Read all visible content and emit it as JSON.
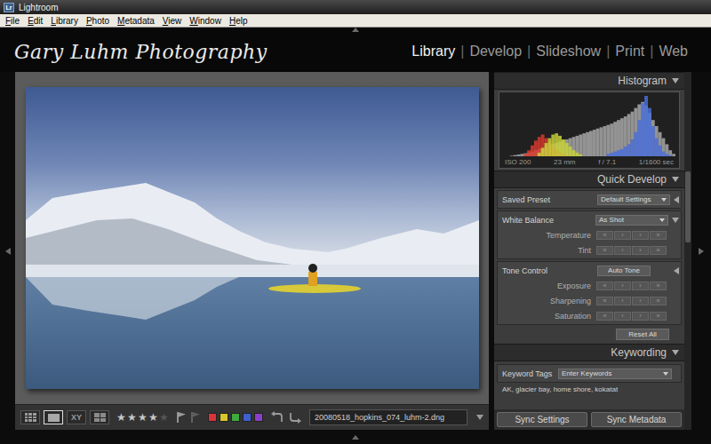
{
  "window": {
    "title": "Lightroom",
    "icon_label": "Lr"
  },
  "menu": [
    "File",
    "Edit",
    "Library",
    "Photo",
    "Metadata",
    "View",
    "Window",
    "Help"
  ],
  "identity_plate": "Gary Luhm Photography",
  "modules": {
    "separator": "|",
    "items": [
      {
        "label": "Library",
        "selected": true
      },
      {
        "label": "Develop",
        "selected": false
      },
      {
        "label": "Slideshow",
        "selected": false
      },
      {
        "label": "Print",
        "selected": false
      },
      {
        "label": "Web",
        "selected": false
      }
    ]
  },
  "toolbar": {
    "view_modes": [
      {
        "kind": "grid",
        "selected": false
      },
      {
        "kind": "loupe",
        "selected": true
      },
      {
        "kind": "compare",
        "label": "XY",
        "selected": false
      },
      {
        "kind": "survey",
        "selected": false
      }
    ],
    "rating": {
      "stars": 4,
      "out_of": 5,
      "glyph": "★"
    },
    "flags": [
      {
        "kind": "pick",
        "selected": false
      },
      {
        "kind": "reject",
        "selected": false
      }
    ],
    "color_labels": [
      {
        "color": "#d8343a",
        "selected": false
      },
      {
        "color": "#d9c62c",
        "selected": false
      },
      {
        "color": "#3fa83f",
        "selected": false
      },
      {
        "color": "#3e5fcf",
        "selected": false
      },
      {
        "color": "#8a3fc8",
        "selected": false
      }
    ],
    "filename": "20080518_hopkins_074_luhm-2.dng"
  },
  "histogram": {
    "title": "Histogram",
    "expanded": true,
    "info": [
      "ISO 200",
      "23 mm",
      "f / 7.1",
      "1/1600 sec"
    ],
    "series": [
      {
        "color": "#a8a8a8",
        "values": [
          0,
          0,
          1,
          2,
          3,
          4,
          5,
          6,
          8,
          10,
          12,
          14,
          16,
          18,
          20,
          22,
          24,
          26,
          28,
          30,
          32,
          34,
          36,
          38,
          40,
          42,
          44,
          46,
          48,
          50,
          52,
          54,
          57,
          60,
          63,
          66,
          70,
          74,
          80,
          86,
          90,
          84,
          72,
          60,
          50,
          40,
          30,
          20,
          10,
          4
        ]
      },
      {
        "color": "#d83a2e",
        "values": [
          0,
          0,
          0,
          0,
          0,
          0,
          4,
          10,
          18,
          26,
          32,
          36,
          30,
          24,
          18,
          12,
          8,
          4,
          2,
          0,
          0,
          0,
          0,
          0,
          0,
          0,
          0,
          0,
          0,
          0,
          0,
          0,
          0,
          0,
          0,
          0,
          0,
          0,
          0,
          0,
          0,
          0,
          0,
          0,
          0,
          0,
          0,
          0,
          0,
          0
        ]
      },
      {
        "color": "#c8d23a",
        "values": [
          0,
          0,
          0,
          0,
          0,
          0,
          0,
          0,
          0,
          0,
          6,
          14,
          22,
          30,
          36,
          38,
          34,
          28,
          22,
          16,
          10,
          6,
          3,
          0,
          0,
          0,
          0,
          0,
          0,
          0,
          0,
          0,
          0,
          0,
          0,
          0,
          0,
          0,
          0,
          0,
          0,
          0,
          0,
          0,
          0,
          0,
          0,
          0,
          0,
          0
        ]
      },
      {
        "color": "#4a6fd8",
        "values": [
          0,
          0,
          0,
          0,
          0,
          0,
          0,
          0,
          0,
          0,
          0,
          0,
          0,
          0,
          0,
          0,
          0,
          0,
          0,
          0,
          0,
          0,
          0,
          0,
          0,
          0,
          0,
          0,
          0,
          0,
          4,
          6,
          8,
          10,
          12,
          16,
          20,
          28,
          40,
          60,
          88,
          100,
          80,
          50,
          30,
          18,
          8,
          4,
          2,
          0
        ]
      }
    ]
  },
  "quick_develop": {
    "title": "Quick Develop",
    "expanded": true,
    "stepper_glyphs": [
      "«",
      "‹",
      "›",
      "»"
    ],
    "groups": [
      {
        "label": "Saved Preset",
        "control": {
          "kind": "dropdown",
          "value": "Default Settings"
        },
        "expanded": false,
        "rows": []
      },
      {
        "label": "White Balance",
        "control": {
          "kind": "dropdown",
          "value": "As Shot"
        },
        "expanded": true,
        "rows": [
          {
            "label": "Temperature"
          },
          {
            "label": "Tint"
          }
        ]
      },
      {
        "label": "Tone Control",
        "control": {
          "kind": "button",
          "value": "Auto Tone"
        },
        "expanded": false,
        "rows": [
          {
            "label": "Exposure"
          },
          {
            "label": "Sharpening"
          },
          {
            "label": "Saturation"
          }
        ]
      }
    ],
    "reset": "Reset All"
  },
  "keywording": {
    "title": "Keywording",
    "expanded": true,
    "tags_label": "Keyword Tags",
    "tags_mode": "Enter Keywords",
    "keywords": "AK, glacier bay, home shore, kokatat"
  },
  "sync_buttons": [
    "Sync Settings",
    "Sync Metadata"
  ]
}
